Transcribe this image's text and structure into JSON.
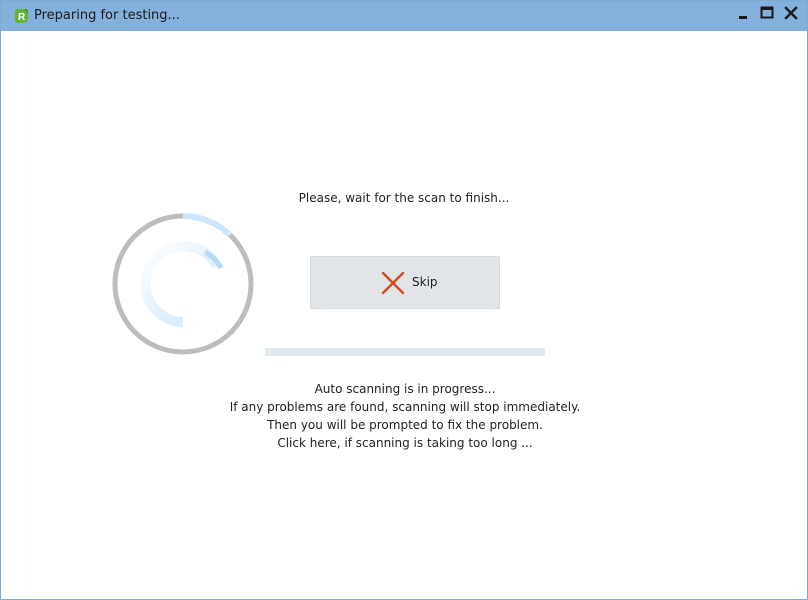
{
  "window": {
    "title": "Preparing for testing...",
    "icon": "app-logo-icon",
    "controls": {
      "minimize": "minimize-icon",
      "maximize": "maximize-icon",
      "close": "close-icon"
    }
  },
  "main": {
    "wait_message": "Please, wait for the scan to finish...",
    "skip_button": {
      "label": "Skip",
      "icon": "x-icon",
      "icon_color": "#d9481b"
    },
    "progress": {
      "fraction": 0.0
    },
    "info_lines": [
      "Auto scanning is in progress...",
      "If any problems are found, scanning will stop immediately.",
      "Then you will be prompted to fix the problem.",
      "Click here, if scanning is taking too long ..."
    ]
  },
  "colors": {
    "titlebar": "#84b0dc",
    "button_bg": "#e1e5e8",
    "progress_track": "#dfe7ef",
    "spinner_ring": "#bdbdbd",
    "spinner_accent": "#cfe6fa"
  }
}
